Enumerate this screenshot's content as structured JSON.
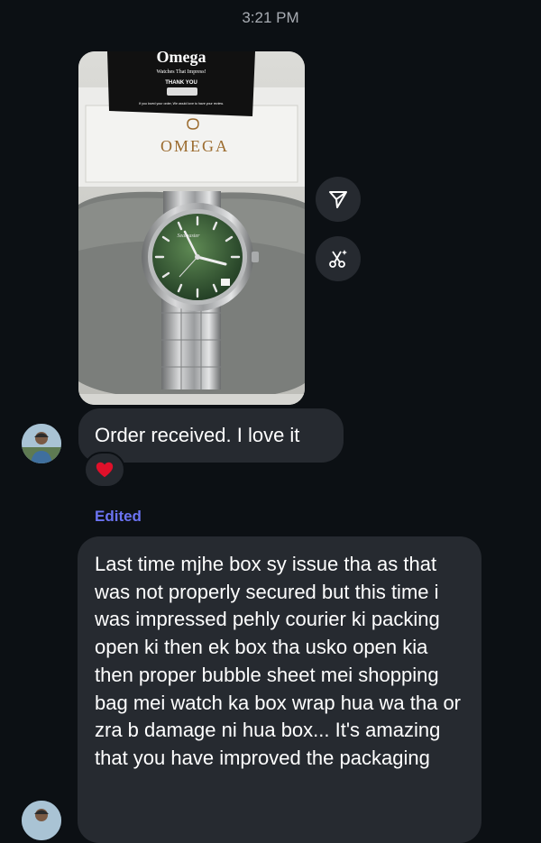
{
  "thread": {
    "timestamp": "3:21 PM"
  },
  "photo": {
    "card_brand": "Omega",
    "card_tagline": "Watches That Impress!",
    "card_thanks": "THANK YOU",
    "card_note": "If you loved your order, We would love to have your review.",
    "box_logo": "OMEGA",
    "dial_text": "Seamaster"
  },
  "actions": [
    {
      "name": "share",
      "icon": "send-icon"
    },
    {
      "name": "remix",
      "icon": "scissors-sparkle-icon"
    }
  ],
  "messages": [
    {
      "text": "Order received. I love it",
      "reaction": "❤️"
    },
    {
      "edited_label": "Edited",
      "text": "Last time mjhe box sy issue tha as that was not properly secured but this time i was impressed pehly courier ki packing open ki then ek box tha usko open kia then proper bubble sheet mei shopping bag mei watch ka box wrap hua wa tha or zra b damage ni hua box... It's amazing that you have improved the packaging"
    }
  ],
  "colors": {
    "background": "#0c1014",
    "bubble": "#262a30",
    "edited": "#6b73f2",
    "dial": "#3f6a3c"
  }
}
